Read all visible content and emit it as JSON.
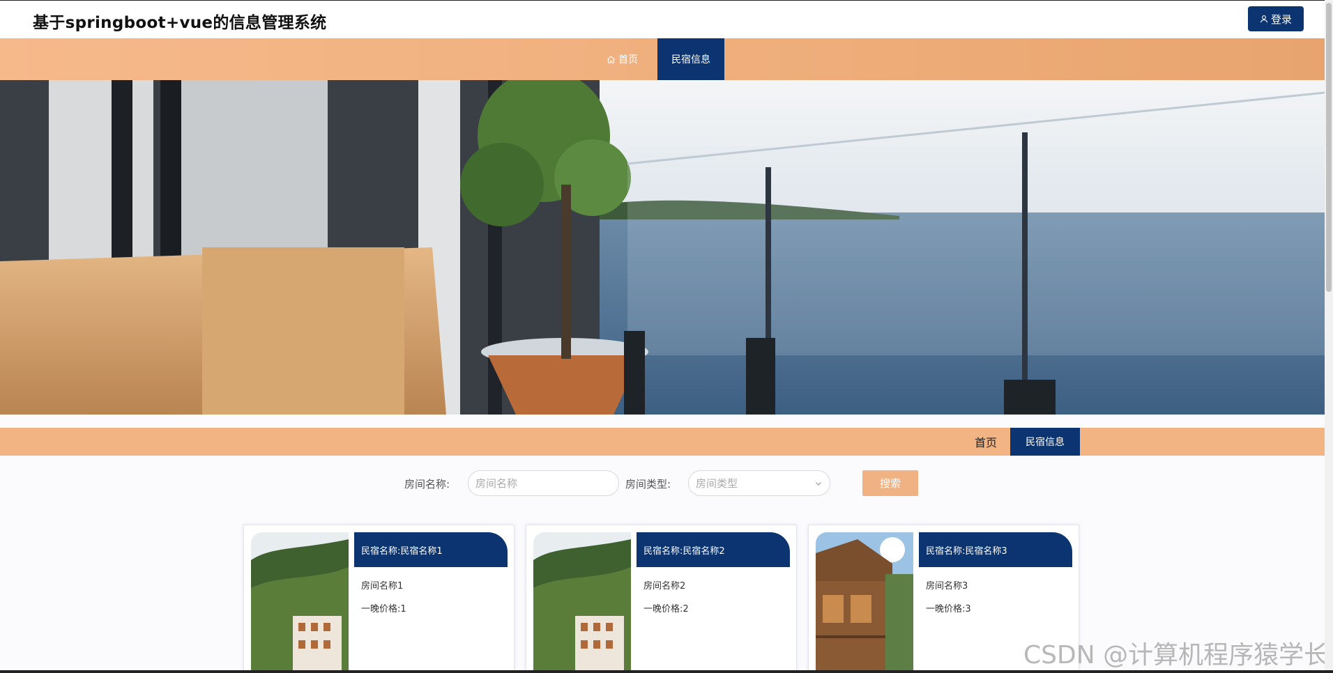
{
  "header": {
    "site_title": "基于springboot+vue的信息管理系统",
    "login_label": "登录"
  },
  "nav": {
    "home_label": "首页",
    "active_label": "民宿信息"
  },
  "subnav": {
    "home_label": "首页",
    "active_label": "民宿信息"
  },
  "search": {
    "room_name_label": "房间名称:",
    "room_name_placeholder": "房间名称",
    "room_type_label": "房间类型:",
    "room_type_placeholder": "房间类型",
    "search_label": "搜索"
  },
  "cards": [
    {
      "title": "民宿名称:民宿名称1",
      "room": "房间名称1",
      "price": "一晚价格:1"
    },
    {
      "title": "民宿名称:民宿名称2",
      "room": "房间名称2",
      "price": "一晚价格:2"
    },
    {
      "title": "民宿名称:民宿名称3",
      "room": "房间名称3",
      "price": "一晚价格:3"
    }
  ],
  "watermark": "CSDN @计算机程序猿学长",
  "colors": {
    "navy": "#0b3470",
    "orange": "#f2b482"
  },
  "icons": {
    "login": "user-icon",
    "home": "home-icon",
    "select": "chevron-down-icon"
  }
}
